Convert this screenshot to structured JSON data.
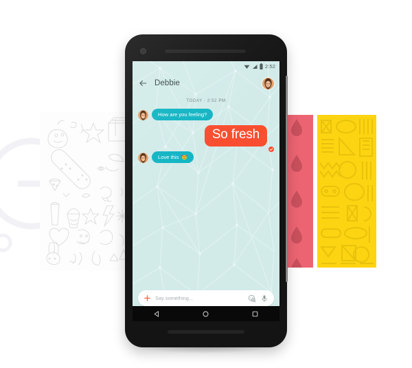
{
  "page": {
    "background_color": "#ffffff"
  },
  "background_watermark": {
    "name": "faint-circle-e-mark",
    "color": "#e9e9f2"
  },
  "panels": [
    {
      "id": "doodle-panel-white",
      "label": "Doodle sticker pack",
      "background": "#fdfdfd",
      "line_color": "#dcdcdc"
    },
    {
      "id": "droplet-panel-pink",
      "label": "Droplet sticker pack",
      "background": "#ec6472",
      "line_color": "#c1505d"
    },
    {
      "id": "pattern-panel-yellow",
      "label": "Geometric sticker pack",
      "background": "#fcd411",
      "line_color": "#edc40a"
    }
  ],
  "phone": {
    "body_color": "#141414",
    "status_bar": {
      "time": "2:52",
      "icons": [
        "wifi-icon",
        "signal-icon",
        "battery-icon"
      ]
    },
    "app_bar": {
      "back_label": "back-arrow-icon",
      "title": "Debbie",
      "avatar_label": "contact-avatar"
    },
    "conversation": {
      "accent_incoming": "#13b5c4",
      "accent_outgoing": "#f94e30",
      "day_stamp": "TODAY · 2:52 PM",
      "messages": [
        {
          "id": "msg-1",
          "direction": "incoming",
          "text": "How are you feeling?",
          "has_avatar": true,
          "emoji": null,
          "delivered": false
        },
        {
          "id": "msg-2",
          "direction": "outgoing",
          "text": "So fresh",
          "has_avatar": false,
          "emoji": null,
          "delivered": true
        },
        {
          "id": "msg-3",
          "direction": "incoming",
          "text": "Love this",
          "has_avatar": true,
          "emoji": "smiling-face-with-hearts-emoji",
          "delivered": false
        }
      ]
    },
    "composer": {
      "placeholder": "Say something...",
      "value": "",
      "plus_icon": "plus-icon",
      "sticker_icon": "sticker-search-icon",
      "mic_icon": "microphone-icon"
    },
    "nav_bar": {
      "back": "nav-back-icon",
      "home": "nav-home-icon",
      "recents": "nav-recents-icon"
    }
  }
}
